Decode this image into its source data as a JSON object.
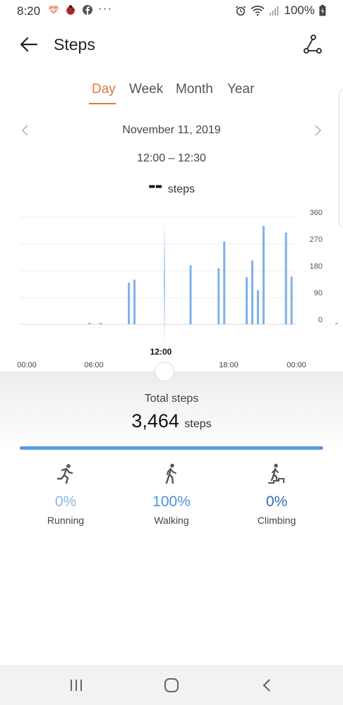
{
  "status_bar": {
    "time": "8:20",
    "more": "···",
    "battery_pct": "100%",
    "icons": [
      "heart-rate-icon",
      "ladybug-icon",
      "facebook-icon",
      "alarm-icon",
      "wifi-icon",
      "signal-icon",
      "battery-icon"
    ]
  },
  "header": {
    "title": "Steps",
    "back_icon": "back-arrow-icon",
    "action_icon": "route-icon"
  },
  "tabs": [
    {
      "label": "Day",
      "active": true
    },
    {
      "label": "Week",
      "active": false
    },
    {
      "label": "Month",
      "active": false
    },
    {
      "label": "Year",
      "active": false
    }
  ],
  "date_nav": {
    "date": "November 11, 2019",
    "time_range": "12:00 – 12:30",
    "value": "--",
    "unit": "steps"
  },
  "chart_data": {
    "type": "bar",
    "ylim": [
      0,
      360
    ],
    "yticks": [
      "360",
      "270",
      "180",
      "90",
      "0"
    ],
    "xtick_labels": [
      "00:00",
      "06:00",
      "12:00",
      "18:00",
      "00:00"
    ],
    "cursor_label": "12:00",
    "bar_color": "#7fb1ea",
    "bars": [
      {
        "x_hour": 5.5,
        "value": 4
      },
      {
        "x_hour": 6.5,
        "value": 4
      },
      {
        "x_hour": 9.0,
        "value": 140
      },
      {
        "x_hour": 9.5,
        "value": 150
      },
      {
        "x_hour": 14.5,
        "value": 198
      },
      {
        "x_hour": 17.0,
        "value": 188
      },
      {
        "x_hour": 17.5,
        "value": 278
      },
      {
        "x_hour": 19.5,
        "value": 158
      },
      {
        "x_hour": 20.0,
        "value": 215
      },
      {
        "x_hour": 20.5,
        "value": 115
      },
      {
        "x_hour": 21.0,
        "value": 330
      },
      {
        "x_hour": 23.0,
        "value": 308
      },
      {
        "x_hour": 23.5,
        "value": 160
      },
      {
        "x_hour": 27.5,
        "value": 4
      }
    ]
  },
  "summary": {
    "total_label": "Total steps",
    "total_value": "3,464",
    "total_unit": "steps",
    "progress_fraction": 1.0,
    "activities": [
      {
        "label": "Running",
        "pct": "0%",
        "color": "#8ab6e6",
        "icon": "running-icon"
      },
      {
        "label": "Walking",
        "pct": "100%",
        "color": "#4f93da",
        "icon": "walking-icon"
      },
      {
        "label": "Climbing",
        "pct": "0%",
        "color": "#2f6fb3",
        "icon": "climbing-icon"
      }
    ]
  },
  "nav_bar": {
    "buttons": [
      "recent-apps-icon",
      "home-icon",
      "back-icon"
    ]
  },
  "colors": {
    "accent": "#e07a3a",
    "bar": "#7fb1ea",
    "progress": "#5b9ae3"
  }
}
